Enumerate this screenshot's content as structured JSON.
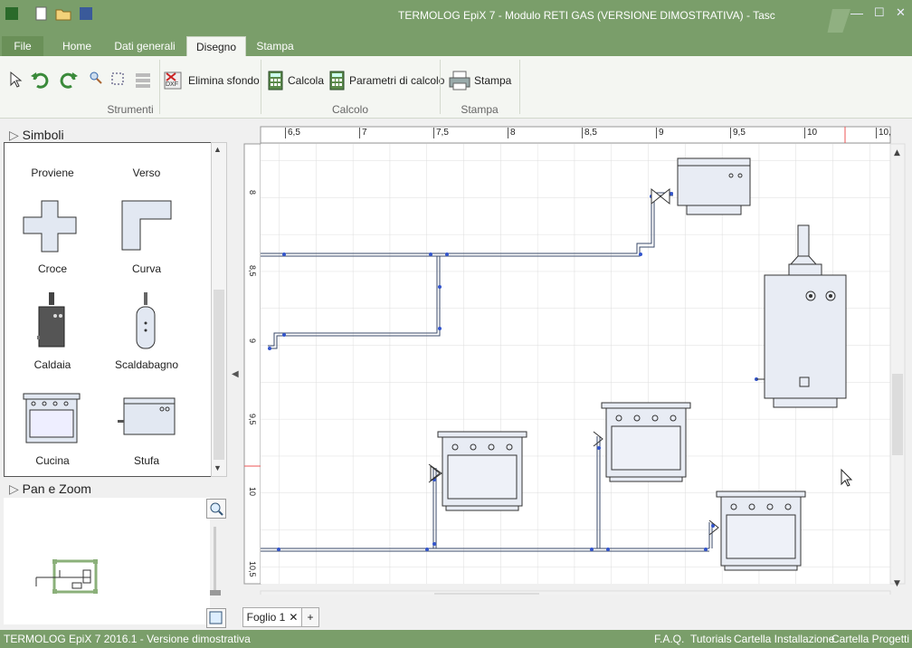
{
  "window": {
    "title": "TERMOLOG EpiX 7 - Modulo RETI GAS (VERSIONE DIMOSTRATIVA) - Tasc",
    "colors": {
      "chrome": "#7a9e6a",
      "ribbon": "#f4f6f2",
      "pipe": "#3355cc"
    }
  },
  "tabs": [
    {
      "label": "File"
    },
    {
      "label": "Home"
    },
    {
      "label": "Dati generali"
    },
    {
      "label": "Disegno"
    },
    {
      "label": "Stampa"
    }
  ],
  "ribbon": {
    "elimina_sfondo": "Elimina sfondo",
    "calcola": "Calcola",
    "parametri": "Parametri di calcolo",
    "stampa": "Stampa",
    "groups": {
      "strumenti": "Strumenti",
      "calcolo": "Calcolo",
      "stampa": "Stampa"
    }
  },
  "left": {
    "simboli": "Simboli",
    "pan_zoom": "Pan e Zoom",
    "symbols": [
      {
        "label": "Proviene",
        "icon": "proviene-icon"
      },
      {
        "label": "Verso",
        "icon": "verso-icon"
      },
      {
        "label": "Croce",
        "icon": "croce-icon"
      },
      {
        "label": "Curva",
        "icon": "curva-icon"
      },
      {
        "label": "Caldaia",
        "icon": "caldaia-icon"
      },
      {
        "label": "Scaldabagno",
        "icon": "scaldabagno-icon"
      },
      {
        "label": "Cucina",
        "icon": "cucina-icon"
      },
      {
        "label": "Stufa",
        "icon": "stufa-icon"
      }
    ]
  },
  "rulers": {
    "top": [
      "6,5",
      "7",
      "7,5",
      "8",
      "8,5",
      "9",
      "9,5",
      "10",
      "10,"
    ],
    "left": [
      "8",
      "8,5",
      "9",
      "9,5",
      "10",
      "10,5"
    ]
  },
  "sheet_tab": {
    "label": "Foglio 1",
    "close": "✕",
    "add": "+"
  },
  "status": {
    "left": "TERMOLOG EpiX 7 2016.1 - Versione dimostrativa",
    "links": [
      "F.A.Q.",
      "Tutorials",
      "Cartella Installazione",
      "Cartella Progetti"
    ]
  }
}
